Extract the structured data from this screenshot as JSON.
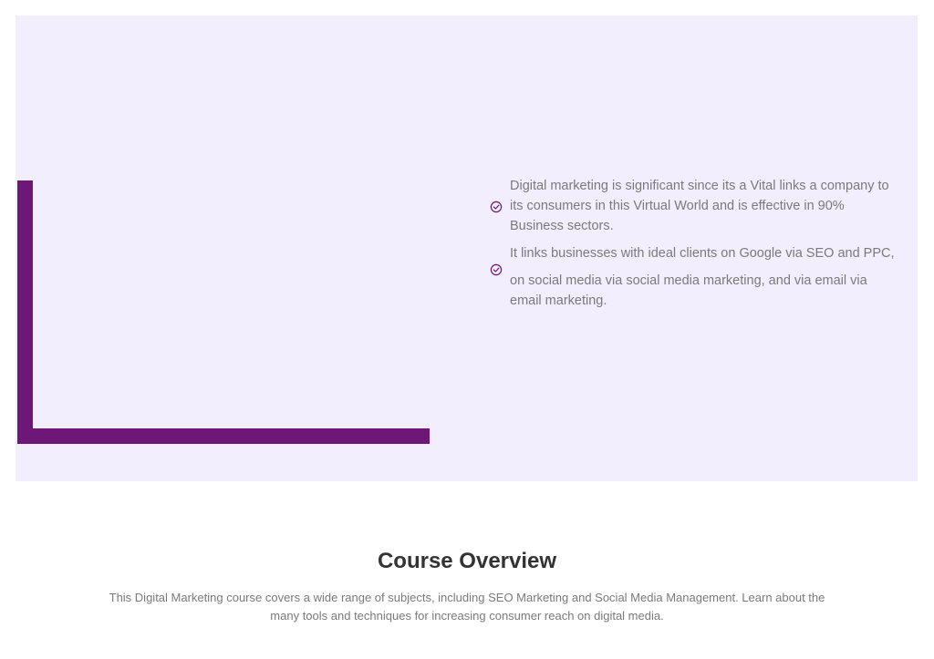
{
  "colors": {
    "hero_background": "#f2eefd",
    "frame_accent": "#6d1778",
    "body_text": "#7a7a7a",
    "heading_text": "#333333"
  },
  "hero": {
    "points": [
      {
        "icon": "check-circle-icon",
        "text": "Digital marketing is significant since its a Vital links a company to its consumers in this Virtual World and is effective in 90% Business sectors."
      },
      {
        "icon": "check-circle-icon",
        "text_line1": "It links businesses with ideal clients on Google via SEO and PPC,",
        "text_line2": "on social media via social media marketing, and via email via email marketing."
      }
    ]
  },
  "overview": {
    "title": "Course Overview",
    "description": "This Digital Marketing course covers a wide range of subjects, including SEO Marketing and Social Media Management. Learn about the many tools and techniques for increasing consumer reach on digital media."
  }
}
